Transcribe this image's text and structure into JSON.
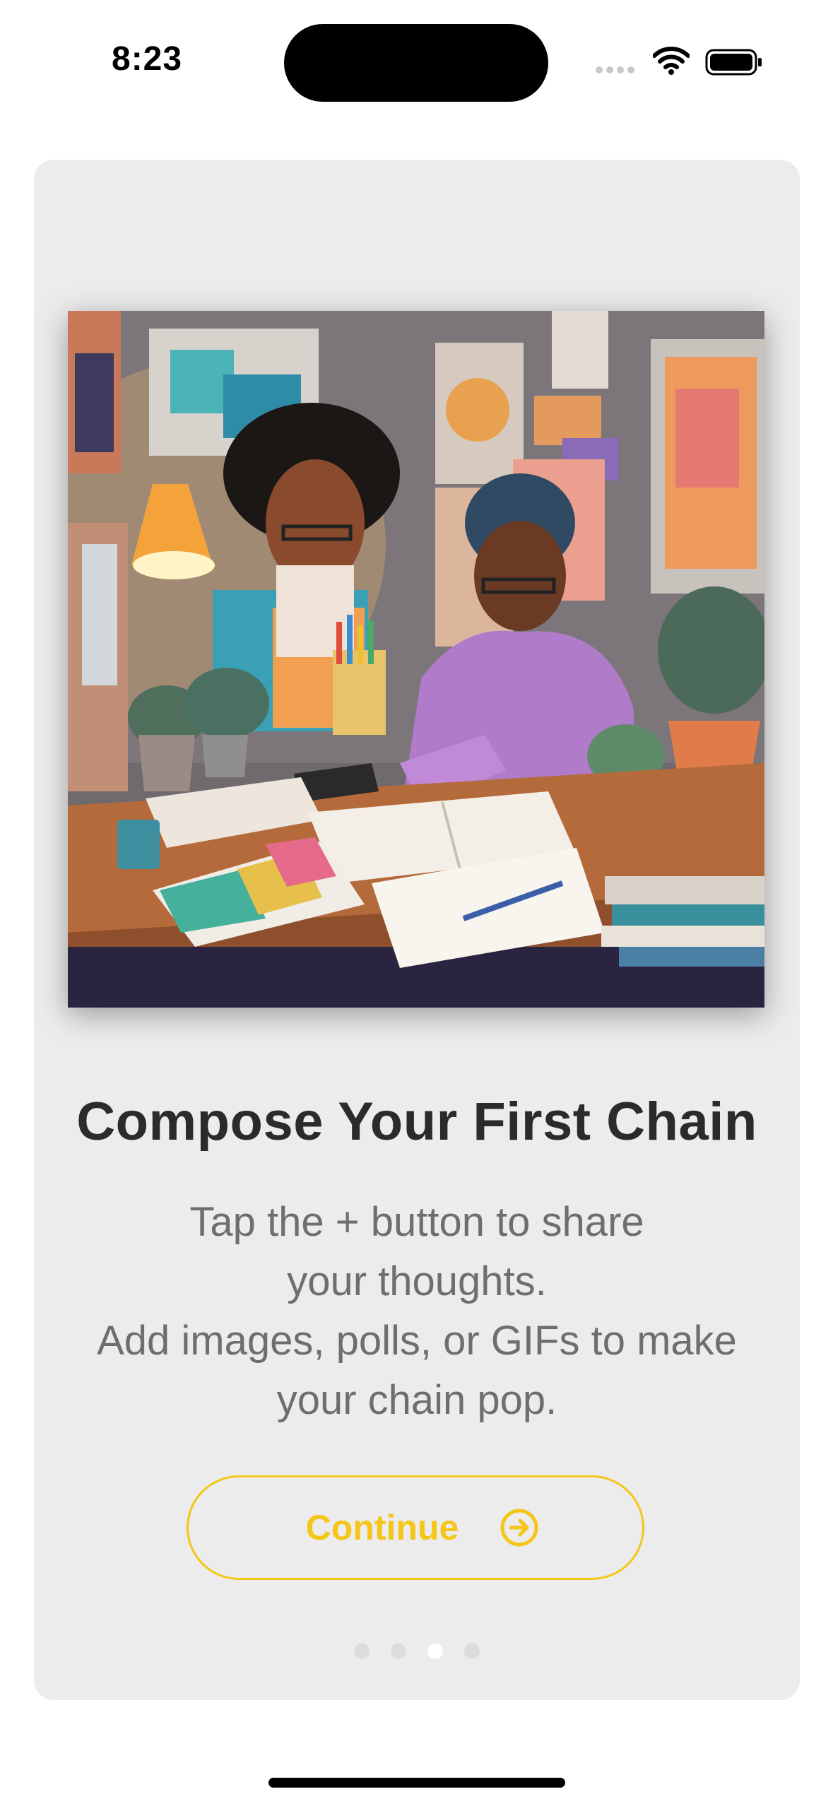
{
  "status_bar": {
    "time": "8:23"
  },
  "onboarding": {
    "title": "Compose Your First Chain",
    "subtitle_lines": [
      "Tap the + button to share",
      "your thoughts.",
      "Add images, polls, or GIFs to make",
      "your chain pop."
    ],
    "continue_label": "Continue",
    "continue_icon": "arrow-right-circle-icon",
    "page_count": 4,
    "current_page": 3
  },
  "colors": {
    "accent": "#f5c518",
    "card_background": "#ececec",
    "title": "#2b2b2b",
    "subtitle": "#6e6e6e"
  }
}
